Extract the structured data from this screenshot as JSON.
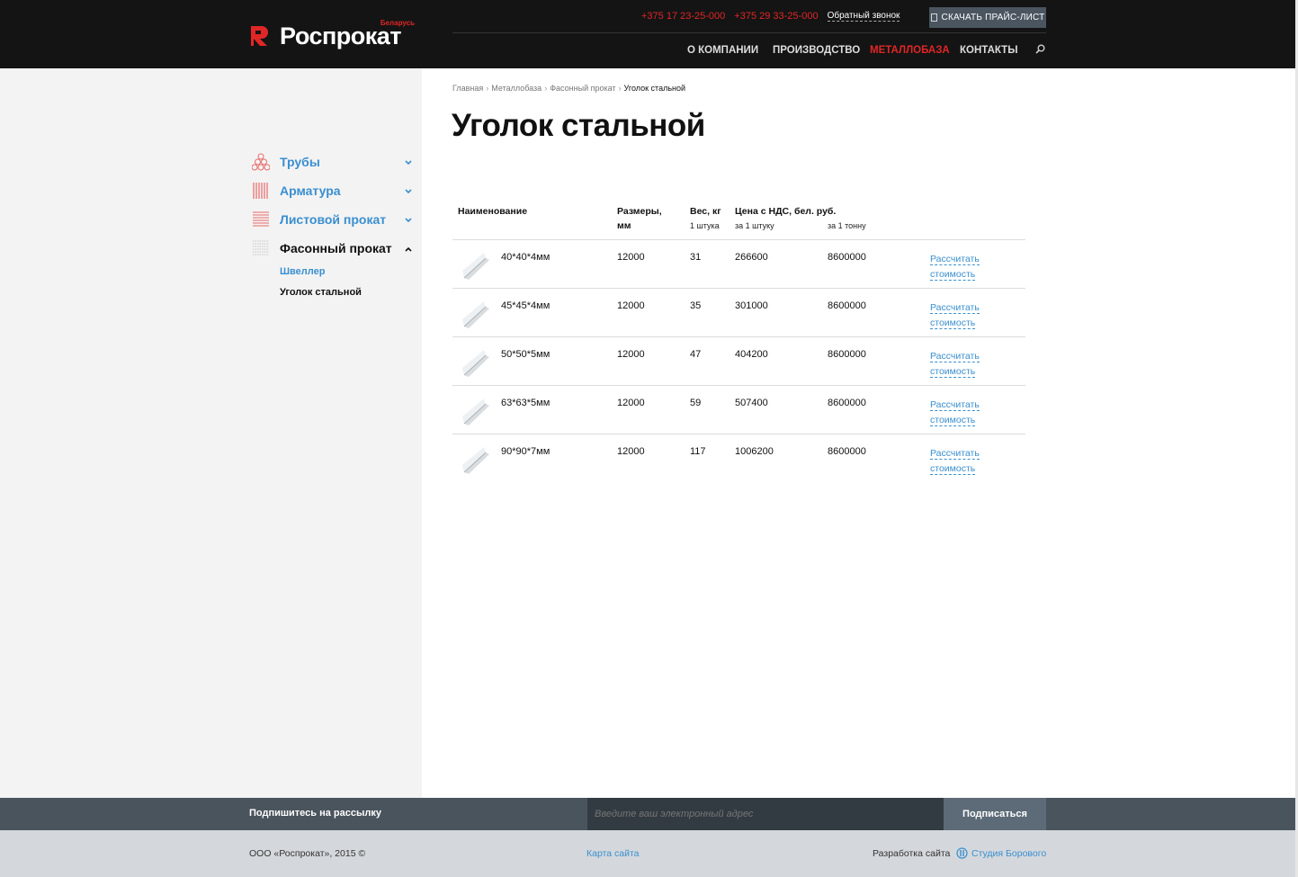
{
  "brand": {
    "name": "Роспрокат",
    "sub": "Беларусь",
    "accent": "#e02626",
    "link_color": "#3a8fd0"
  },
  "header": {
    "phone1": "+375 17 23-25-000",
    "phone2": "+375 29 33-25-000",
    "callback": "Обратный звонок",
    "price_button": "СКАЧАТЬ ПРАЙС-ЛИСТ",
    "nav": [
      "О КОМПАНИИ",
      "ПРОИЗВОДСТВО",
      "МЕТАЛЛОБАЗА",
      "КОНТАКТЫ"
    ],
    "nav_active": "МЕТАЛЛОБАЗА"
  },
  "sidebar": {
    "categories": [
      {
        "label": "Трубы",
        "icon": "pipes-icon"
      },
      {
        "label": "Арматура",
        "icon": "rebar-icon"
      },
      {
        "label": "Листовой прокат",
        "icon": "sheet-icon"
      },
      {
        "label": "Фасонный прокат",
        "icon": "profile-icon",
        "active": true
      }
    ],
    "subitems": [
      {
        "label": "Швеллер"
      },
      {
        "label": "Уголок стальной",
        "current": true
      }
    ]
  },
  "breadcrumb": [
    "Главная",
    "Металлобаза",
    "Фасонный прокат",
    "Уголок стальной"
  ],
  "page_title": "Уголок стальной",
  "table": {
    "headers": {
      "name": "Наименование",
      "size": "Размеры,",
      "size2": "мм",
      "weight": "Вес, кг",
      "weight_sub": "1 штука",
      "price": "Цена с НДС, бел. руб.",
      "price_unit": "за 1 штуку",
      "price_ton": "за 1 тонну"
    },
    "calc_line1": "Рассчитать",
    "calc_line2": "стоимость",
    "rows": [
      {
        "name": "40*40*4мм",
        "size": "12000",
        "weight": "31",
        "price_unit": "266600",
        "price_ton": "8600000"
      },
      {
        "name": "45*45*4мм",
        "size": "12000",
        "weight": "35",
        "price_unit": "301000",
        "price_ton": "8600000"
      },
      {
        "name": "50*50*5мм",
        "size": "12000",
        "weight": "47",
        "price_unit": "404200",
        "price_ton": "8600000"
      },
      {
        "name": "63*63*5мм",
        "size": "12000",
        "weight": "59",
        "price_unit": "507400",
        "price_ton": "8600000"
      },
      {
        "name": "90*90*7мм",
        "size": "12000",
        "weight": "117",
        "price_unit": "1006200",
        "price_ton": "8600000"
      }
    ]
  },
  "subscribe": {
    "label": "Подпишитесь на рассылку",
    "placeholder": "Введите ваш электронный адрес",
    "button": "Подписаться"
  },
  "footer": {
    "copyright": "ООО «Роспрокат», 2015 ©",
    "sitemap": "Карта сайта",
    "dev_label": "Разработка сайта",
    "studio": "Студия Борового"
  }
}
